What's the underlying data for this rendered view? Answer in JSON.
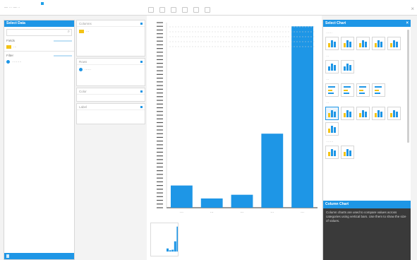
{
  "topbar": {
    "left_text": "— ··· — ··",
    "close_glyph": "×"
  },
  "left_panel": {
    "title": "Select Data",
    "search_placeholder": "",
    "sections": [
      {
        "label": "Fields",
        "items": [
          {
            "label": "···",
            "color": "#f3c316"
          }
        ]
      },
      {
        "label": "Filter",
        "items": [
          {
            "label": "·········",
            "color": "#1e96e6"
          }
        ]
      }
    ]
  },
  "mid_panel": {
    "zones": [
      {
        "title": "Columns",
        "item": "···"
      },
      {
        "title": "Rows",
        "item": "······"
      },
      {
        "title": "Color",
        "item": ""
      },
      {
        "title": "Label",
        "item": ""
      }
    ]
  },
  "chart_data": {
    "type": "bar",
    "categories": [
      "···",
      "···",
      "···",
      "···",
      "···"
    ],
    "values": [
      12,
      5,
      7,
      40,
      98
    ],
    "ylim": [
      0,
      100
    ],
    "bar_color": "#1e96e6",
    "grid": false,
    "xlabel": "",
    "ylabel": ""
  },
  "right_panel": {
    "title": "Select Chart",
    "groups": [
      {
        "label": "······",
        "count": 5
      },
      {
        "label": "···",
        "count": 2
      },
      {
        "label": "···",
        "count": 4
      },
      {
        "label": "···",
        "count": 6
      },
      {
        "label": "·······",
        "count": 2
      }
    ],
    "description_title": "Column Chart",
    "description_text": "Column charts are used to compare values across categories using vertical bars. Use them to show the size of values."
  },
  "colors": {
    "accent": "#1e96e6",
    "secondary": "#f3c316",
    "dark_panel": "#3a3a3a"
  }
}
